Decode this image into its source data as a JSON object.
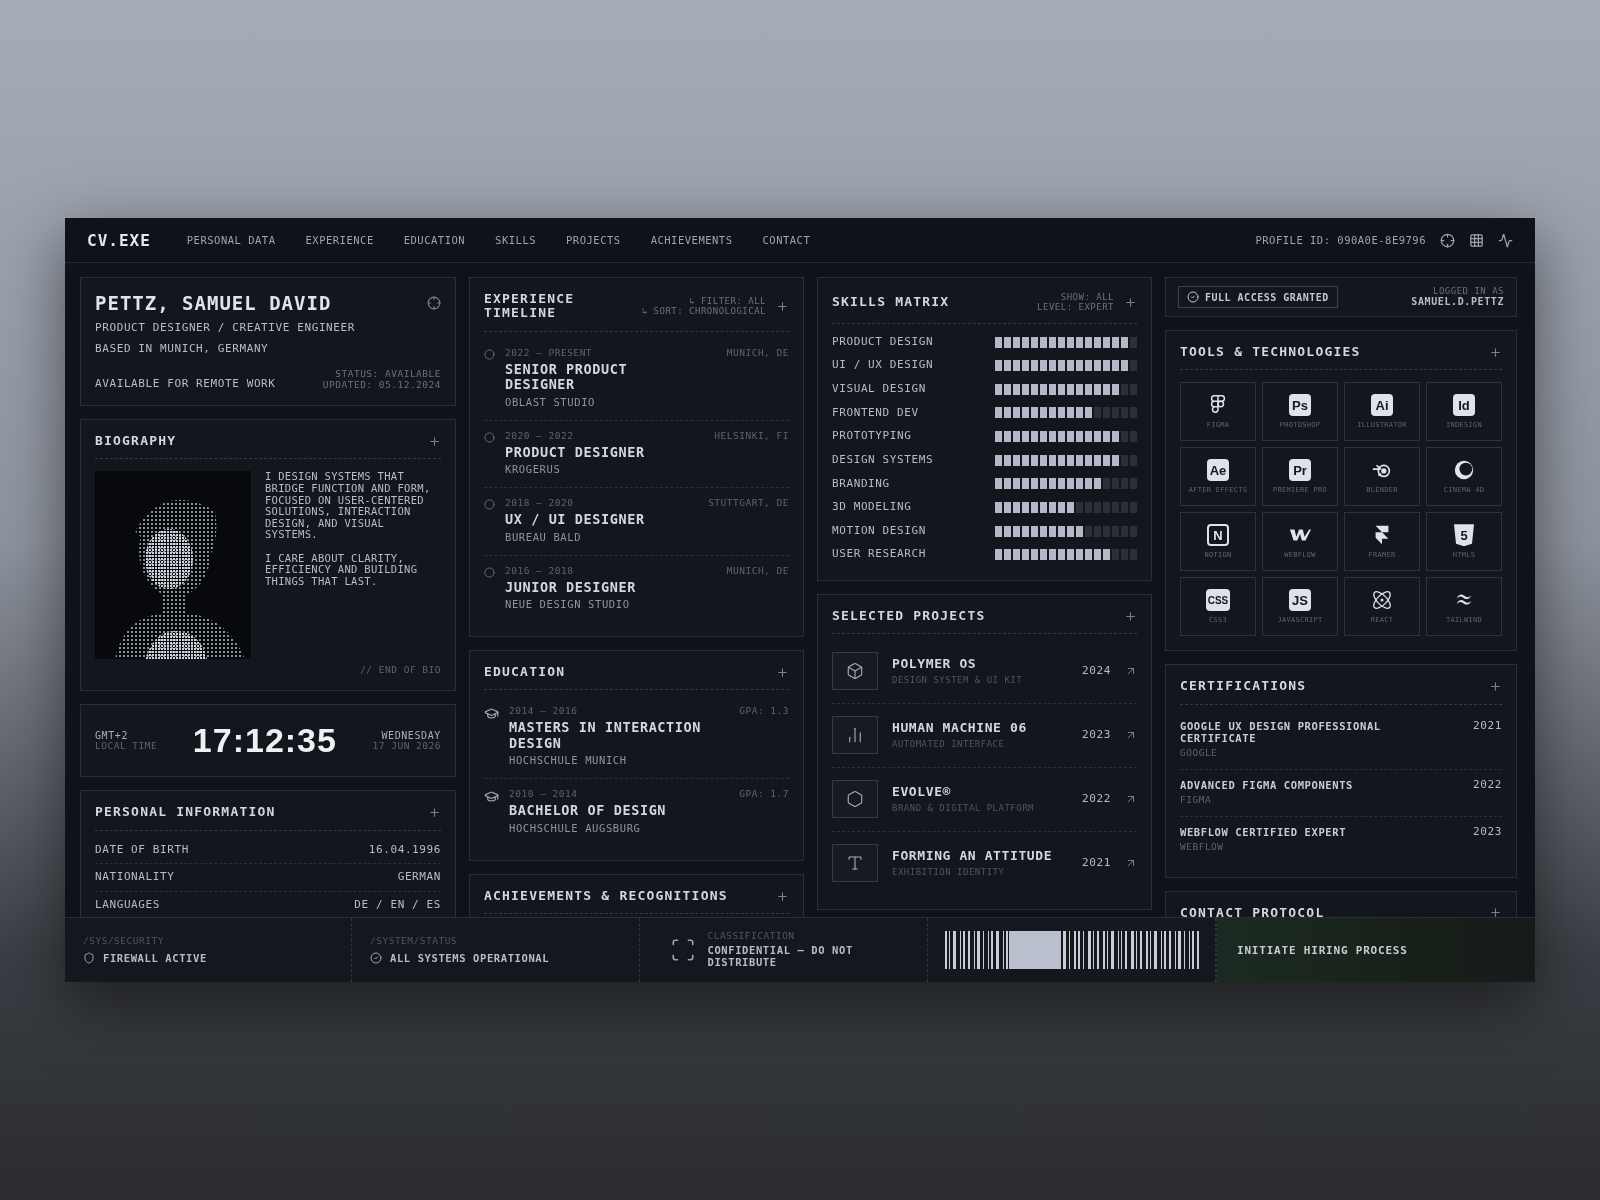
{
  "header": {
    "logo": "CV.EXE",
    "nav": [
      "PERSONAL DATA",
      "EXPERIENCE",
      "EDUCATION",
      "SKILLS",
      "PROJECTS",
      "ACHIEVEMENTS",
      "CONTACT"
    ],
    "profile_id": "PROFILE ID: 090A0E-8E9796"
  },
  "identity": {
    "name": "PETTZ, SAMUEL DAVID",
    "title": "PRODUCT DESIGNER / CREATIVE ENGINEER",
    "location": "BASED IN MUNICH, GERMANY",
    "remote": "AVAILABLE FOR REMOTE WORK",
    "status": "STATUS: AVAILABLE",
    "updated": "UPDATED: 05.12.2024"
  },
  "biography": {
    "title": "BIOGRAPHY",
    "paragraphs": [
      "I DESIGN SYSTEMS THAT BRIDGE FUNCTION AND FORM, FOCUSED ON USER-CENTERED SOLUTIONS, INTERACTION DESIGN, AND VISUAL SYSTEMS.",
      "I CARE ABOUT CLARITY, EFFICIENCY AND BUILDING THINGS THAT LAST."
    ],
    "footer": "// END OF BIO"
  },
  "clock": {
    "zone": "GMT+2",
    "zone_label": "LOCAL TIME",
    "time": "17:12:35",
    "day": "WEDNESDAY",
    "date": "17 JUN 2026"
  },
  "personal_info": {
    "title": "PERSONAL INFORMATION",
    "rows": [
      {
        "label": "DATE OF BIRTH",
        "value": "16.04.1996"
      },
      {
        "label": "NATIONALITY",
        "value": "GERMAN"
      },
      {
        "label": "LANGUAGES",
        "value": "DE / EN / ES"
      }
    ]
  },
  "experience": {
    "title": "EXPERIENCE TIMELINE",
    "filter": "↳ FILTER: ALL",
    "sort": "↳ SORT: CHRONOLOGICAL",
    "items": [
      {
        "period": "2022 – PRESENT",
        "location": "MUNICH, DE",
        "role": "SENIOR PRODUCT DESIGNER",
        "company": "OBLAST STUDIO"
      },
      {
        "period": "2020 – 2022",
        "location": "HELSINKI, FI",
        "role": "PRODUCT DESIGNER",
        "company": "KROGERUS"
      },
      {
        "period": "2018 – 2020",
        "location": "STUTTGART, DE",
        "role": "UX / UI DESIGNER",
        "company": "BUREAU BALD"
      },
      {
        "period": "2016 – 2018",
        "location": "MUNICH, DE",
        "role": "JUNIOR DESIGNER",
        "company": "NEUE DESIGN STUDIO"
      }
    ]
  },
  "education": {
    "title": "EDUCATION",
    "items": [
      {
        "period": "2014 – 2016",
        "gpa": "GPA: 1.3",
        "degree": "MASTERS IN INTERACTION DESIGN",
        "school": "HOCHSCHULE MUNICH"
      },
      {
        "period": "2010 – 2014",
        "gpa": "GPA: 1.7",
        "degree": "BACHELOR OF DESIGN",
        "school": "HOCHSCHULE AUGSBURG"
      }
    ]
  },
  "achievements": {
    "title": "ACHIEVEMENTS & RECOGNITIONS"
  },
  "skills": {
    "title": "SKILLS MATRIX",
    "show": "SHOW: ALL",
    "level_filter": "LEVEL: EXPERT",
    "items": [
      {
        "name": "PRODUCT DESIGN",
        "level": 0.9375
      },
      {
        "name": "UI / UX DESIGN",
        "level": 0.9375
      },
      {
        "name": "VISUAL DESIGN",
        "level": 0.875
      },
      {
        "name": "FRONTEND DEV",
        "level": 0.6875
      },
      {
        "name": "PROTOTYPING",
        "level": 0.875
      },
      {
        "name": "DESIGN SYSTEMS",
        "level": 0.875
      },
      {
        "name": "BRANDING",
        "level": 0.75
      },
      {
        "name": "3D MODELING",
        "level": 0.5625
      },
      {
        "name": "MOTION DESIGN",
        "level": 0.625
      },
      {
        "name": "USER RESEARCH",
        "level": 0.8125
      }
    ]
  },
  "projects": {
    "title": "SELECTED PROJECTS",
    "items": [
      {
        "kind": "cube",
        "name": "POLYMER OS",
        "subtitle": "DESIGN SYSTEM & UI KIT",
        "year": "2024"
      },
      {
        "kind": "chart",
        "name": "HUMAN MACHINE 06",
        "subtitle": "AUTOMATED INTERFACE",
        "year": "2023"
      },
      {
        "kind": "hexagon",
        "name": "EVOLVE®",
        "subtitle": "BRAND & DIGITAL PLATFORM",
        "year": "2022"
      },
      {
        "kind": "type",
        "name": "FORMING AN ATTITUDE",
        "subtitle": "EXHIBITION IDENTITY",
        "year": "2021"
      }
    ]
  },
  "access": {
    "badge": "FULL ACCESS GRANTED",
    "logged_label": "LOGGED IN AS",
    "user": "SAMUEL.D.PETTZ"
  },
  "tools": {
    "title": "TOOLS & TECHNOLOGIES",
    "items": [
      {
        "kind": "figma",
        "name": "FIGMA"
      },
      {
        "kind": "badge",
        "badge": "Ps",
        "name": "PHOTOSHOP"
      },
      {
        "kind": "badge",
        "badge": "Ai",
        "name": "ILLUSTRATOR"
      },
      {
        "kind": "badge",
        "badge": "Id",
        "name": "INDESIGN"
      },
      {
        "kind": "badge",
        "badge": "Ae",
        "name": "AFTER EFFECTS"
      },
      {
        "kind": "badge",
        "badge": "Pr",
        "name": "PREMIERE PRO"
      },
      {
        "kind": "blender",
        "name": "BLENDER"
      },
      {
        "kind": "cinema",
        "name": "CINEMA 4D"
      },
      {
        "kind": "outline",
        "badge": "N",
        "name": "NOTION"
      },
      {
        "kind": "webflow",
        "name": "WEBFLOW"
      },
      {
        "kind": "framer",
        "name": "FRAMER"
      },
      {
        "kind": "shield",
        "badge": "5",
        "name": "HTML5"
      },
      {
        "kind": "badge",
        "badge": "CSS",
        "name": "CSS3"
      },
      {
        "kind": "badge",
        "badge": "JS",
        "name": "JAVASCRIPT"
      },
      {
        "kind": "react",
        "name": "REACT"
      },
      {
        "kind": "tailwind",
        "name": "TAILWIND"
      }
    ]
  },
  "certifications": {
    "title": "CERTIFICATIONS",
    "items": [
      {
        "name": "GOOGLE UX DESIGN PROFESSIONAL CERTIFICATE",
        "issuer": "GOOGLE",
        "year": "2021"
      },
      {
        "name": "ADVANCED FIGMA COMPONENTS",
        "issuer": "FIGMA",
        "year": "2022"
      },
      {
        "name": "WEBFLOW CERTIFIED EXPERT",
        "issuer": "WEBFLOW",
        "year": "2023"
      }
    ]
  },
  "contact": {
    "title": "CONTACT PROTOCOL"
  },
  "status_bar": {
    "security": {
      "path": "/SYS/SECURITY",
      "label": "FIREWALL ACTIVE"
    },
    "status": {
      "path": "/SYSTEM/STATUS",
      "label": "ALL SYSTEMS OPERATIONAL"
    },
    "classification": {
      "path": "CLASSIFICATION",
      "label": "CONFIDENTIAL – DO NOT DISTRIBUTE"
    },
    "cta": "INITIATE HIRING PROCESS"
  }
}
